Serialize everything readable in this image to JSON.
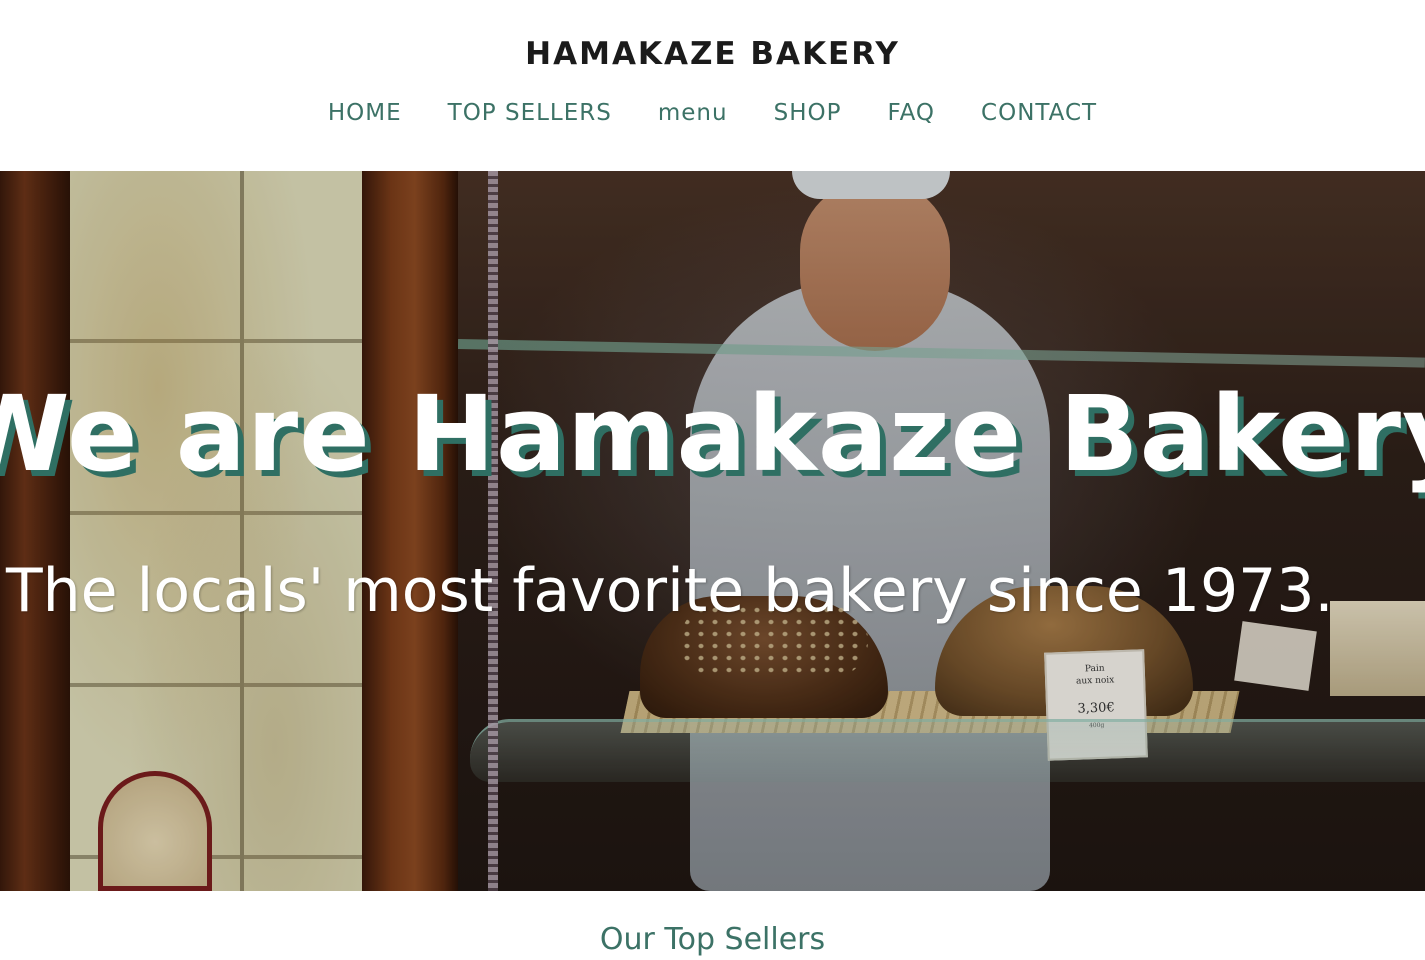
{
  "header": {
    "brand": "HAMAKAZE BAKERY",
    "nav": [
      {
        "label": "HOME"
      },
      {
        "label": "TOP SELLERS"
      },
      {
        "label": "menu"
      },
      {
        "label": "SHOP"
      },
      {
        "label": "FAQ"
      },
      {
        "label": "CONTACT"
      }
    ]
  },
  "hero": {
    "title": "We are Hamakaze Bakery",
    "subtitle": "The locals' most favorite bakery since 1973.",
    "price_card": {
      "name_line1": "Pain",
      "name_line2": "aux noix",
      "price": "3,30€",
      "weight": "400g"
    }
  },
  "sections": {
    "top_sellers_heading": "Our Top Sellers"
  },
  "colors": {
    "accent": "#3c7266",
    "title_shadow": "#2f6f63",
    "brand_text": "#1b1b1b"
  }
}
